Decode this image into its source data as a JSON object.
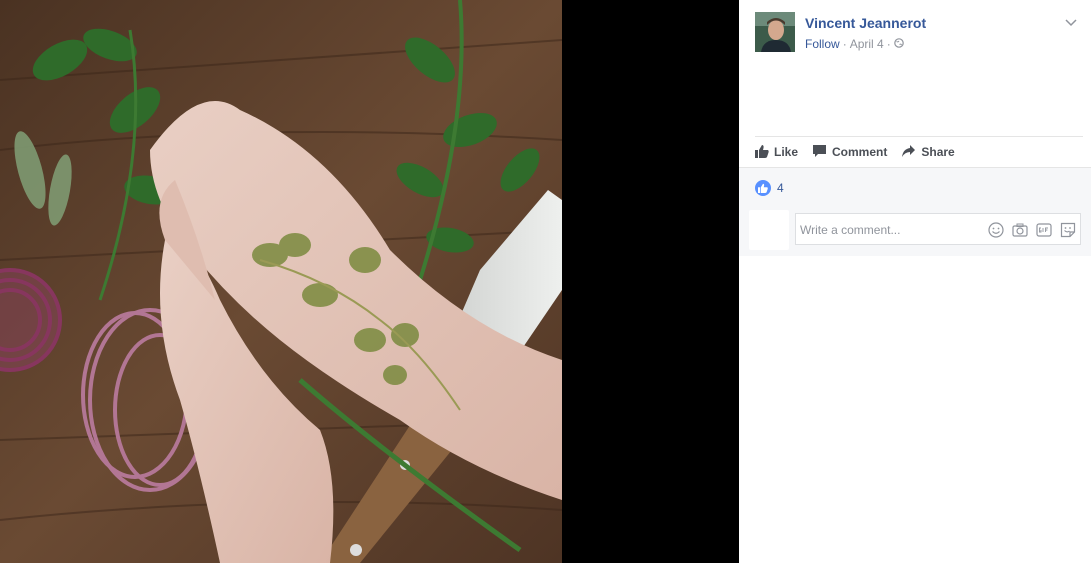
{
  "post": {
    "author": "Vincent Jeannerot",
    "follow_label": "Follow",
    "sep1": "·",
    "date": "April 4",
    "sep2": "·"
  },
  "actions": {
    "like": "Like",
    "comment": "Comment",
    "share": "Share"
  },
  "reactions": {
    "count": "4"
  },
  "comment_box": {
    "placeholder": "Write a comment..."
  },
  "icons": {
    "privacy": "globe-icon",
    "more": "chevron-down-icon",
    "like": "thumbs-up-icon",
    "comment": "speech-bubble-icon",
    "share": "share-arrow-icon",
    "emoji": "smiley-icon",
    "camera": "camera-icon",
    "gif": "gif-icon",
    "sticker": "sticker-icon"
  },
  "colors": {
    "link": "#365899",
    "muted": "#90949c",
    "action": "#4b4f56",
    "like_blue": "#5890ff",
    "panel_bg": "#f6f7f9",
    "photo_backdrop": "#000000"
  }
}
